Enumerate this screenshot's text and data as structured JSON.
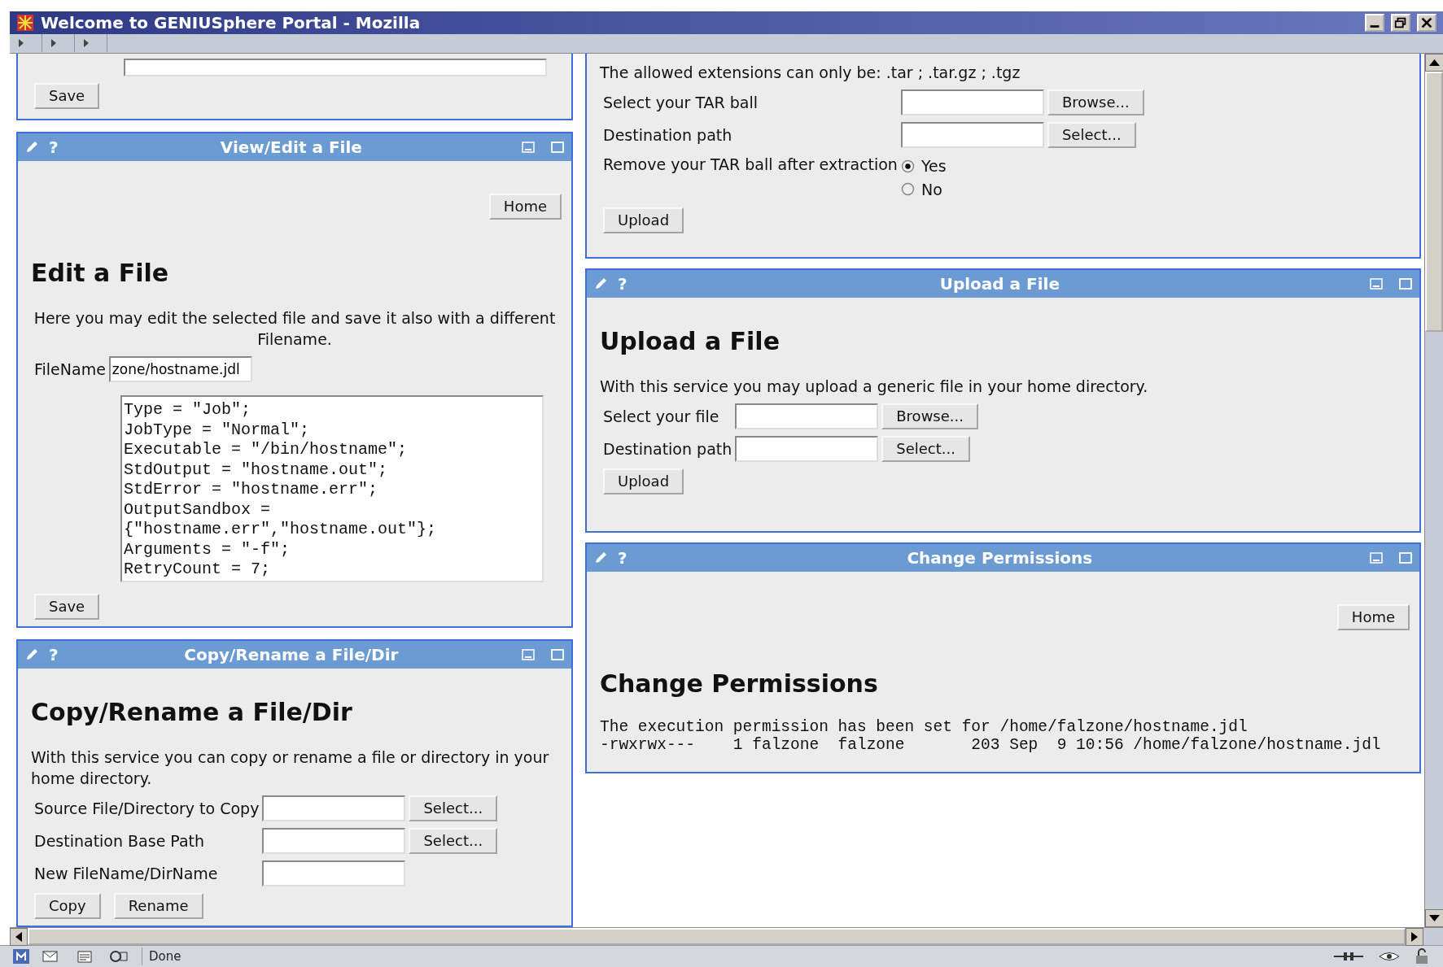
{
  "window": {
    "title": "Welcome to GENIUSphere Portal - Mozilla"
  },
  "left_column": [
    {
      "kind": "fragment",
      "blocks": [
        {
          "kind": "input"
        },
        {
          "kind": "buttons",
          "labels": [
            "Save"
          ]
        }
      ]
    },
    {
      "kind": "portlet",
      "title": "View/Edit a File",
      "help": "?",
      "blocks": [
        {
          "kind": "home",
          "label": "Home"
        },
        {
          "kind": "heading",
          "text": "Edit a File"
        },
        {
          "kind": "centered_paragraph",
          "text": "Here you may edit the selected file and save it also with a different Filename."
        },
        {
          "kind": "form",
          "rows": [
            {
              "kind": "field",
              "label": "FileName",
              "value": "zone/hostname.jdl"
            }
          ]
        },
        {
          "kind": "textarea",
          "value": "Type = \"Job\";\nJobType = \"Normal\";\nExecutable = \"/bin/hostname\";\nStdOutput = \"hostname.out\";\nStdError = \"hostname.err\";\nOutputSandbox =\n{\"hostname.err\",\"hostname.out\"};\nArguments = \"-f\";\nRetryCount = 7;"
        },
        {
          "kind": "buttons",
          "labels": [
            "Save"
          ]
        }
      ]
    },
    {
      "kind": "portlet",
      "title": "Copy/Rename a File/Dir",
      "help": "?",
      "blocks": [
        {
          "kind": "heading",
          "text": "Copy/Rename a File/Dir"
        },
        {
          "kind": "paragraph",
          "text": "With this service you can copy or rename a file or directory in your home directory."
        },
        {
          "kind": "form",
          "rows": [
            {
              "kind": "field",
              "label": "Source File/Directory to Copy",
              "button": "Select..."
            },
            {
              "kind": "field",
              "label": "Destination Base Path",
              "button": "Select..."
            },
            {
              "kind": "field",
              "label": "New FileName/DirName"
            }
          ]
        },
        {
          "kind": "buttons",
          "labels": [
            "Copy",
            "Rename"
          ]
        }
      ]
    }
  ],
  "right_column": [
    {
      "kind": "fragment",
      "blocks": [
        {
          "kind": "paragraph",
          "text": "The allowed extensions can only be: .tar ; .tar.gz ; .tgz"
        },
        {
          "kind": "form",
          "rows": [
            {
              "kind": "field",
              "label": "Select your TAR ball",
              "button": "Browse..."
            },
            {
              "kind": "field",
              "label": "Destination path",
              "button": "Select..."
            },
            {
              "kind": "radio",
              "label": "Remove your TAR ball after extraction",
              "options": [
                {
                  "label": "Yes",
                  "selected": true
                },
                {
                  "label": "No",
                  "selected": false
                }
              ]
            }
          ]
        },
        {
          "kind": "buttons",
          "labels": [
            "Upload"
          ]
        }
      ]
    },
    {
      "kind": "portlet",
      "title": "Upload a File",
      "help": "?",
      "blocks": [
        {
          "kind": "heading",
          "text": "Upload a File"
        },
        {
          "kind": "paragraph",
          "text": "With this service you may upload a generic file in your home directory."
        },
        {
          "kind": "form",
          "rows": [
            {
              "kind": "field",
              "label": "Select your file",
              "button": "Browse..."
            },
            {
              "kind": "field",
              "label": "Destination path",
              "button": "Select..."
            }
          ]
        },
        {
          "kind": "buttons",
          "labels": [
            "Upload"
          ]
        }
      ]
    },
    {
      "kind": "portlet",
      "title": "Change Permissions",
      "help": "?",
      "blocks": [
        {
          "kind": "home",
          "label": "Home"
        },
        {
          "kind": "heading",
          "text": "Change Permissions"
        },
        {
          "kind": "pre",
          "text": "The execution permission has been set for /home/falzone/hostname.jdl\n-rwxrwx---    1 falzone  falzone       203 Sep  9 10:56 /home/falzone/hostname.jdl"
        }
      ]
    }
  ],
  "status_bar": {
    "text": "Done"
  }
}
